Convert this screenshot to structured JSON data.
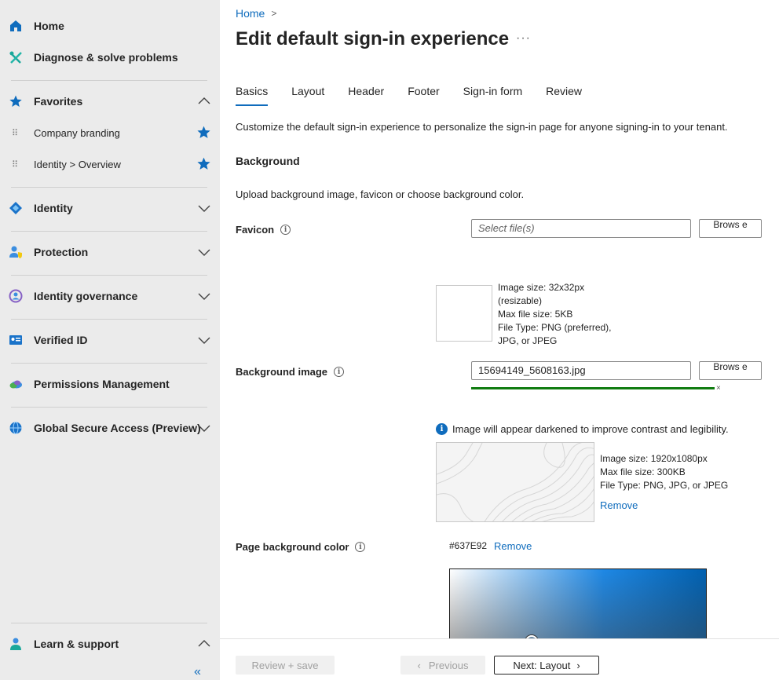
{
  "sidebar": {
    "home": "Home",
    "diagnose": "Diagnose & solve problems",
    "favorites": "Favorites",
    "fav_items": [
      "Company branding",
      "Identity > Overview"
    ],
    "identity": "Identity",
    "protection": "Protection",
    "governance": "Identity governance",
    "verified_id": "Verified ID",
    "permissions": "Permissions Management",
    "global_access": "Global Secure Access (Preview)",
    "learn": "Learn & support",
    "collapse": "«"
  },
  "breadcrumb": {
    "home": "Home",
    "sep": ">"
  },
  "page": {
    "title": "Edit default sign-in experience",
    "more": "···"
  },
  "tabs": [
    "Basics",
    "Layout",
    "Header",
    "Footer",
    "Sign-in form",
    "Review"
  ],
  "content": {
    "intro": "Customize the default sign-in experience to personalize the sign-in page for anyone signing-in to your tenant.",
    "section_background": "Background",
    "sub_intro": "Upload background image, favicon or choose background color.",
    "favicon_label": "Favicon",
    "favicon_placeholder": "Select file(s)",
    "browse": "Brows e",
    "favicon_spec": [
      "Image size: 32x32px",
      "(resizable)",
      "Max file size: 5KB",
      "File Type: PNG (preferred),",
      "JPG, or JPEG"
    ],
    "bg_label": "Background image",
    "bg_value": "15694149_5608163.jpg",
    "progress_close": "×",
    "notice": "Image will appear darkened to improve contrast and legibility.",
    "bg_spec": [
      "Image size: 1920x1080px",
      "Max file size: 300KB",
      "File Type: PNG, JPG, or JPEG"
    ],
    "bg_remove": "Remove",
    "color_label": "Page background color",
    "color_value": "#637E92",
    "color_remove": "Remove"
  },
  "footer": {
    "review_save": "Review + save",
    "previous": "Previous",
    "next": "Next: Layout"
  },
  "colors": {
    "accent": "#0f6cbd",
    "progress": "#107c10",
    "page_bg": "#637E92"
  }
}
